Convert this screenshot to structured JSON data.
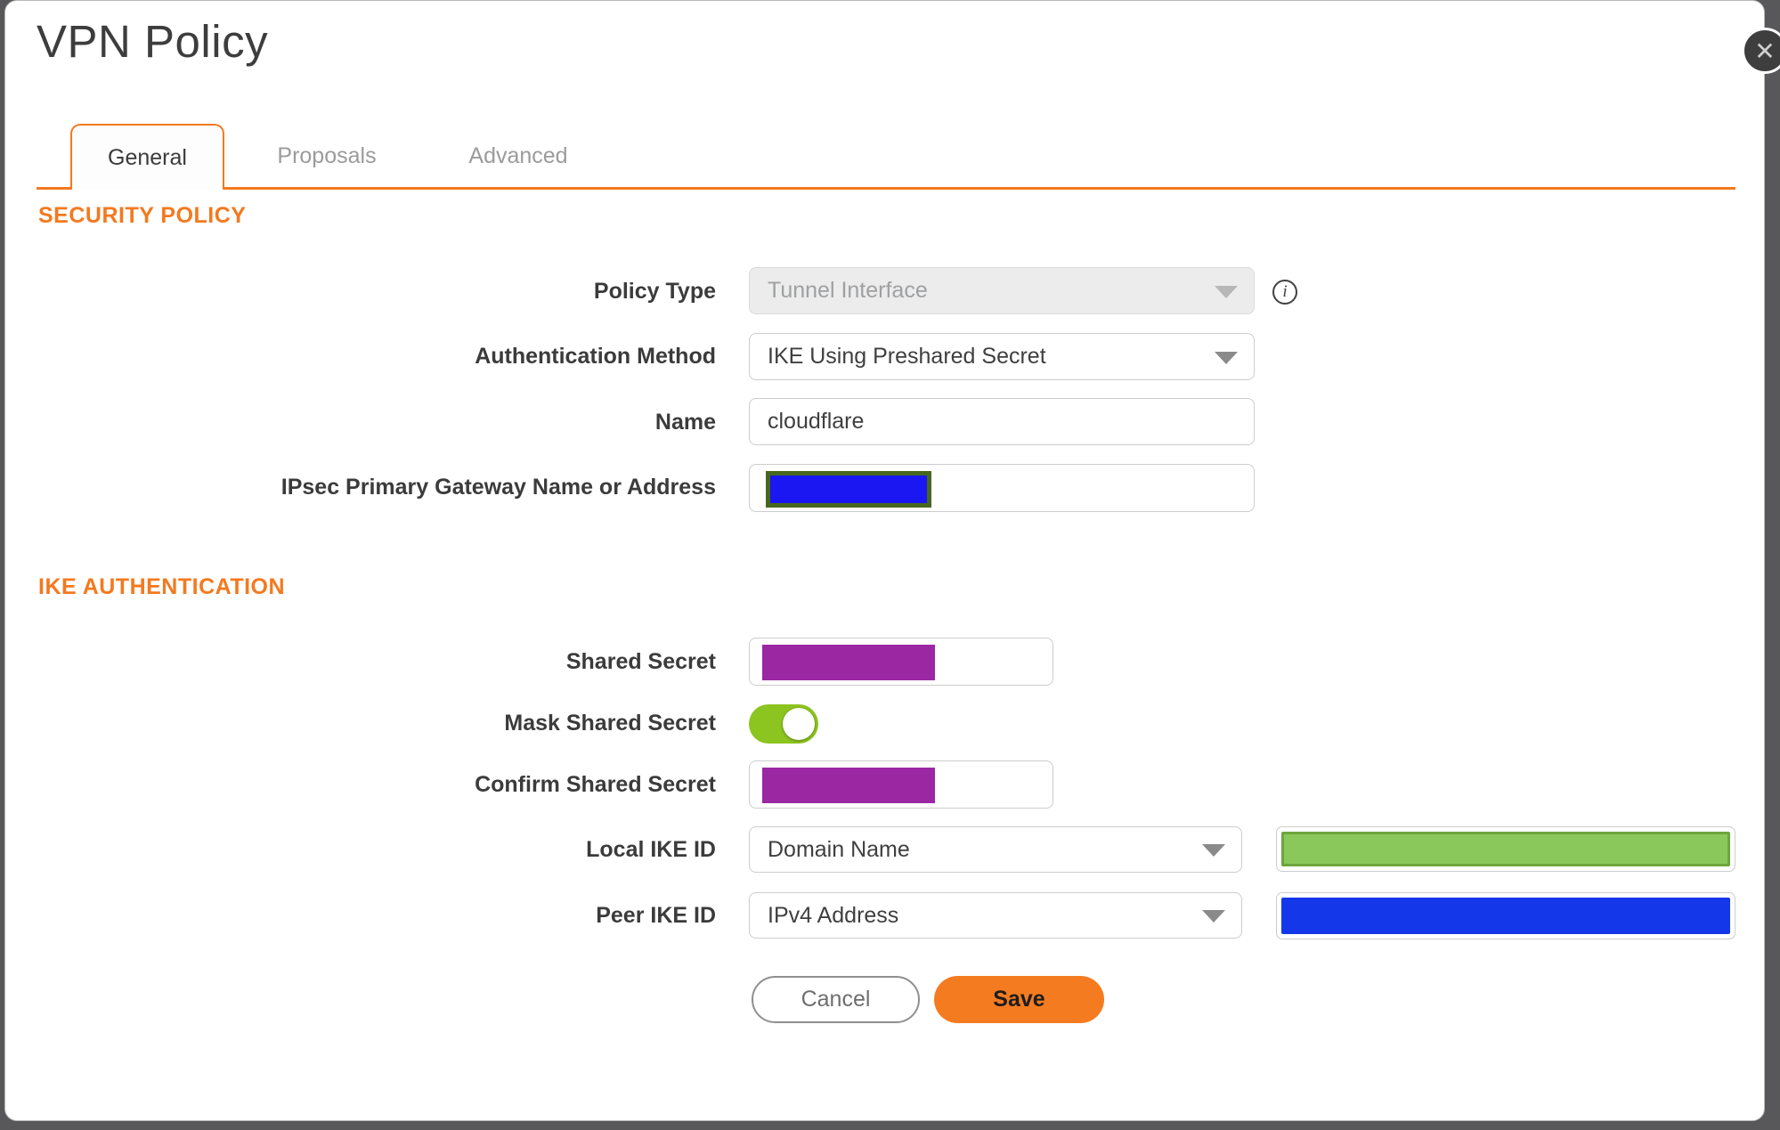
{
  "header": {
    "title": "VPN Policy",
    "close_glyph": "✕"
  },
  "tabs": {
    "general": {
      "label": "General",
      "active": true
    },
    "proposals": {
      "label": "Proposals",
      "active": false
    },
    "advanced": {
      "label": "Advanced",
      "active": false
    }
  },
  "security": {
    "heading": "SECURITY POLICY",
    "policy_type": {
      "label": "Policy Type",
      "value": "Tunnel Interface",
      "disabled": true,
      "info_glyph": "i"
    },
    "auth_method": {
      "label": "Authentication Method",
      "value": "IKE Using Preshared Secret"
    },
    "name": {
      "label": "Name",
      "value": "cloudflare"
    },
    "gateway": {
      "label": "IPsec Primary Gateway Name or Address",
      "value": ""
    }
  },
  "ike": {
    "heading": "IKE AUTHENTICATION",
    "shared_secret": {
      "label": "Shared Secret",
      "value": "",
      "masked": true
    },
    "mask_shared_secret": {
      "label": "Mask Shared Secret",
      "enabled": true
    },
    "confirm_shared_secret": {
      "label": "Confirm Shared Secret",
      "value": "",
      "masked": true
    },
    "local_ike_id": {
      "label": "Local IKE ID",
      "type": "Domain Name",
      "value": ""
    },
    "peer_ike_id": {
      "label": "Peer IKE ID",
      "type": "IPv4 Address",
      "value": ""
    }
  },
  "actions": {
    "cancel": "Cancel",
    "save": "Save"
  },
  "colors": {
    "accent_orange": "#f4791f",
    "save_button": "#f57b20",
    "backdrop_gray": "#58585a",
    "toggle_green": "#8cc420",
    "redaction_purple": "#9b27a2",
    "redaction_gateway_blue": "#1a17f2",
    "redaction_gateway_border": "#48671e",
    "redaction_local_green": "#8bc85c",
    "redaction_local_border": "#6ca63c",
    "redaction_peer_blue": "#1437ea",
    "close_button_bg": "#3e3e3e"
  }
}
